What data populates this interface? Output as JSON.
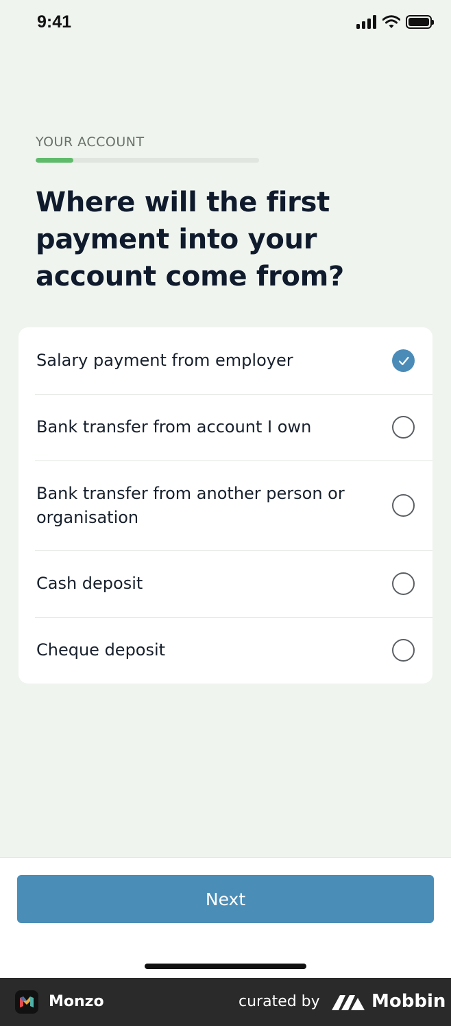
{
  "status_bar": {
    "time": "9:41",
    "icons": [
      "signal-icon",
      "wifi-icon",
      "battery-icon"
    ]
  },
  "header": {
    "section_label": "YOUR ACCOUNT",
    "progress_fraction": 0.17,
    "progress_color": "#5fbb6a"
  },
  "question": "Where will the first payment into your account come from?",
  "options": [
    {
      "label": "Salary payment from employer",
      "selected": true
    },
    {
      "label": "Bank transfer from account I own",
      "selected": false
    },
    {
      "label": "Bank transfer from another person or organisation",
      "selected": false
    },
    {
      "label": "Cash deposit",
      "selected": false
    },
    {
      "label": "Cheque deposit",
      "selected": false
    }
  ],
  "actions": {
    "next_label": "Next",
    "next_color": "#4a8db7"
  },
  "footer": {
    "app_name": "Monzo",
    "curated_by": "curated by",
    "brand": "Mobbin"
  },
  "colors": {
    "background": "#eff4ef",
    "selected_radio": "#4a8bb8",
    "heading": "#0f1a2c"
  }
}
